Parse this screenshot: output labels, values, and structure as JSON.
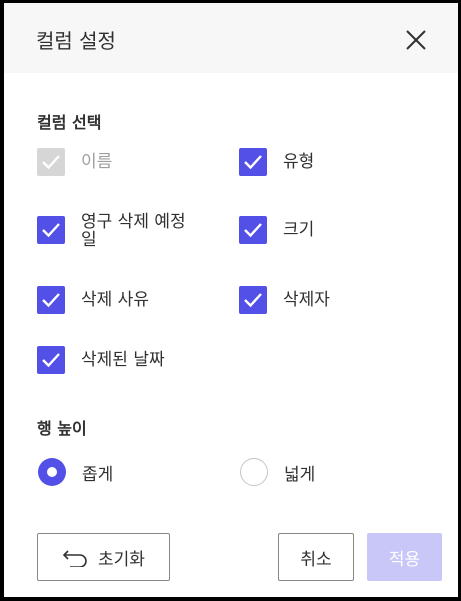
{
  "dialog": {
    "title": "컬럼 설정",
    "close_icon": "close-icon"
  },
  "columns": {
    "label": "컬럼 선택",
    "items": [
      {
        "label": "이름",
        "checked": true,
        "disabled": true
      },
      {
        "label": "유형",
        "checked": true,
        "disabled": false
      },
      {
        "label": "영구 삭제 예정일",
        "checked": true,
        "disabled": false
      },
      {
        "label": "크기",
        "checked": true,
        "disabled": false
      },
      {
        "label": "삭제 사유",
        "checked": true,
        "disabled": false
      },
      {
        "label": "삭제자",
        "checked": true,
        "disabled": false
      },
      {
        "label": "삭제된 날짜",
        "checked": true,
        "disabled": false
      }
    ]
  },
  "row_height": {
    "label": "행 높이",
    "options": [
      {
        "label": "좁게",
        "checked": true
      },
      {
        "label": "넓게",
        "checked": false
      }
    ]
  },
  "footer": {
    "reset_label": "초기화",
    "reset_icon": "undo-arrow-icon",
    "cancel_label": "취소",
    "apply_label": "적용"
  },
  "colors": {
    "accent": "#5250e6",
    "disabled_check": "#d6d6d6",
    "apply_disabled": "#c8c7f8",
    "header_bg": "#f7f7f7"
  }
}
